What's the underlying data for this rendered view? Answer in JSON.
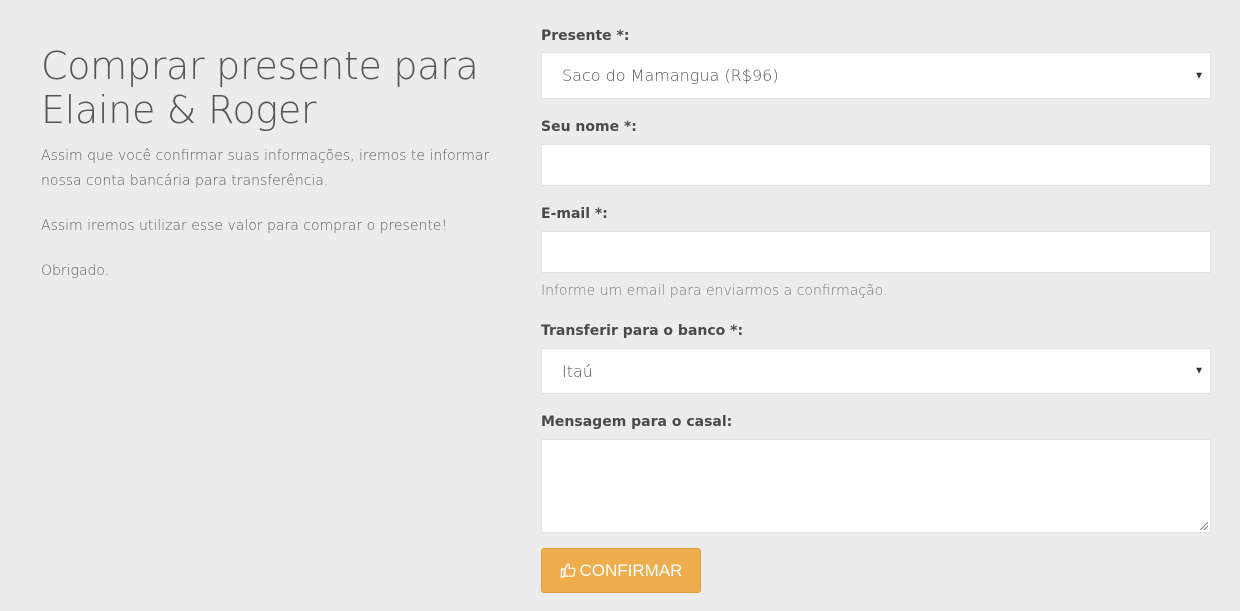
{
  "intro": {
    "title_line1": "Comprar presente para",
    "title_line2": "Elaine & Roger",
    "paragraph1": "Assim que você confirmar suas informações, iremos te informar nossa conta bancária para transferência.",
    "paragraph2": "Assim iremos utilizar esse valor para comprar o presente!",
    "paragraph3": "Obrigado."
  },
  "form": {
    "gift": {
      "label": "Presente *:",
      "value": "Saco do Mamangua (R$96)"
    },
    "name": {
      "label": "Seu nome *:",
      "value": ""
    },
    "email": {
      "label": "E-mail *:",
      "value": "",
      "help": "Informe um email para enviarmos a confirmação."
    },
    "bank": {
      "label": "Transferir para o banco *:",
      "value": "Itaú"
    },
    "message": {
      "label": "Mensagem para o casal:",
      "value": ""
    },
    "submit_label": "CONFIRMAR"
  },
  "icons": {
    "submit": "thumbs-up-icon",
    "dropdown": "caret-down-icon"
  },
  "colors": {
    "background": "#ececec",
    "button": "#efae4e",
    "button_text": "#ffffff"
  }
}
